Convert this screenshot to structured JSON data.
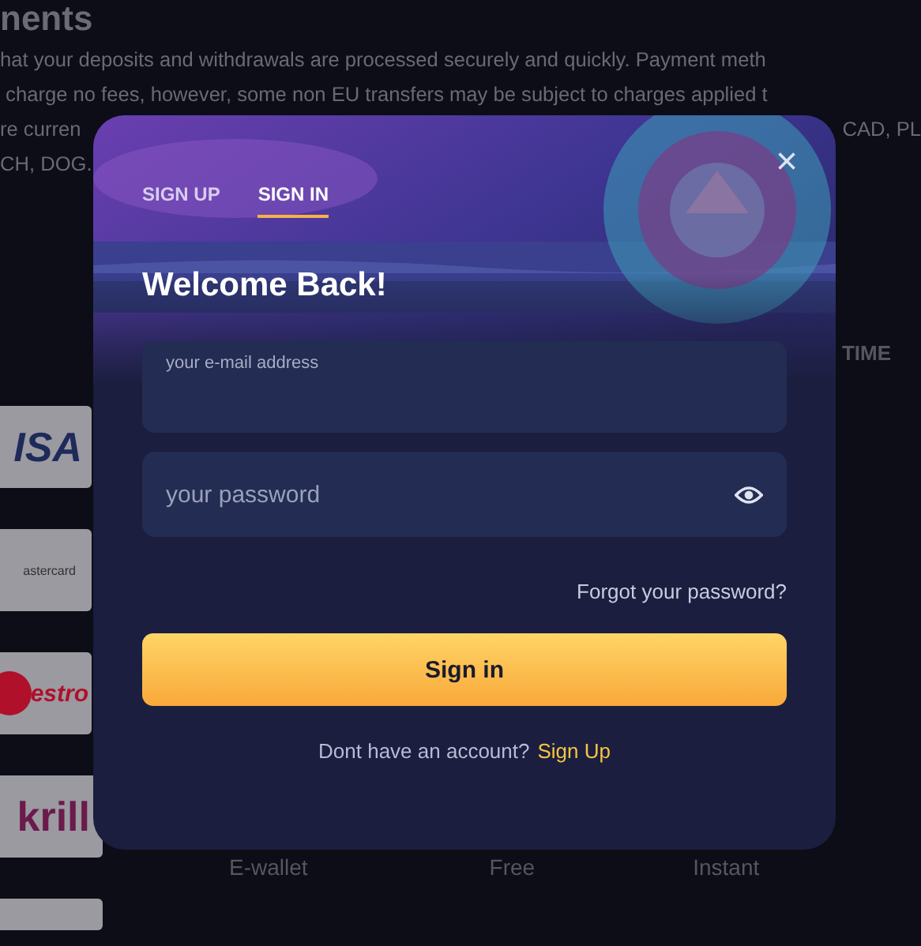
{
  "page": {
    "heading": "nents",
    "paragraph_lines": [
      {
        "left": "hat your deposits and withdrawals are processed securely and quickly. Payment meth"
      },
      {
        "left": " charge no fees, however, some non EU transfers may be subject to charges applied t"
      },
      {
        "left": "re curren",
        "right": "CAD, PL"
      },
      {
        "left": "CH, DOG."
      }
    ],
    "column_header": "TIME",
    "methods": [
      {
        "logo": "ISA",
        "kind": "visa"
      },
      {
        "logo": "astercard",
        "kind": "mastercard"
      },
      {
        "logo": "estro",
        "kind": "maestro"
      },
      {
        "logo": "krill",
        "kind": "skrill",
        "type": "E-wallet",
        "fee": "Free",
        "time": "Instant"
      },
      {
        "kind": "blank"
      }
    ]
  },
  "modal": {
    "tabs": [
      {
        "label": "SIGN UP",
        "selected": false
      },
      {
        "label": "SIGN IN",
        "selected": true
      }
    ],
    "close": "×",
    "title": "Welcome Back!",
    "email": {
      "placeholder": "your e-mail address"
    },
    "password": {
      "placeholder": "your password"
    },
    "forgot": "Forgot your password?",
    "submit": "Sign in",
    "footer": {
      "text": "Dont have an account?",
      "link": "Sign Up"
    }
  }
}
